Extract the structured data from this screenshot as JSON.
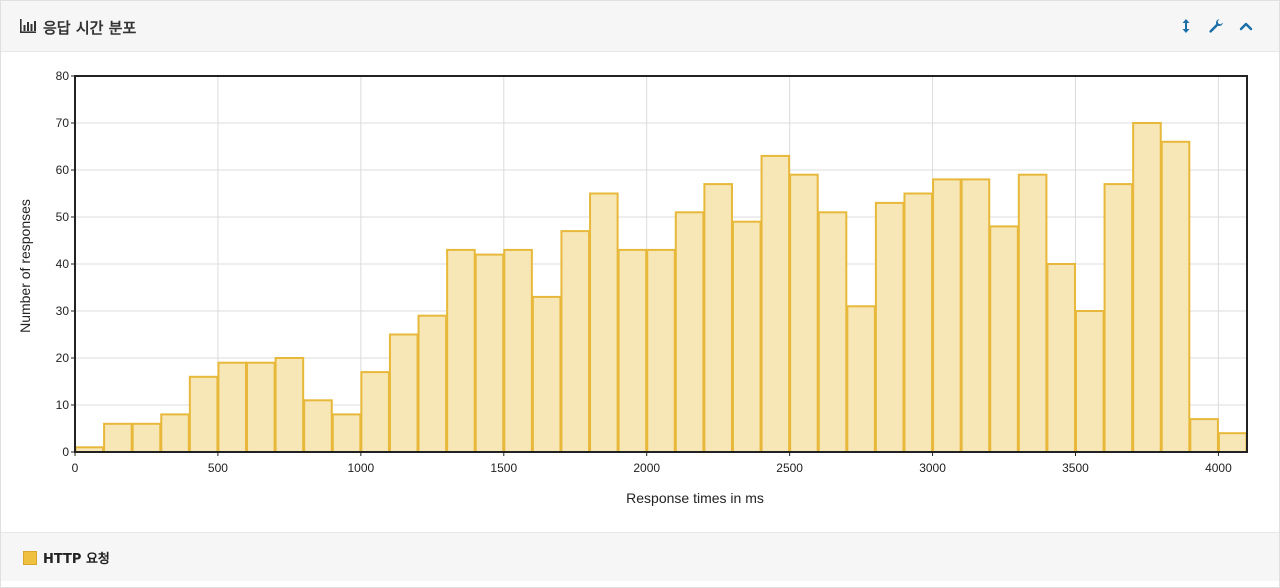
{
  "panel": {
    "title": "응답 시간 분포",
    "title_icon": "bar-chart-icon",
    "tools": [
      {
        "name": "resize-vertical-icon",
        "glyph": "↕"
      },
      {
        "name": "wrench-icon",
        "glyph": "🔧"
      },
      {
        "name": "collapse-icon",
        "glyph": "⌃"
      }
    ]
  },
  "legend": {
    "label": "HTTP 요청"
  },
  "colors": {
    "bar_fill": "#f7e6b6",
    "bar_stroke": "#e7b83a",
    "accent": "#1a6fa8"
  },
  "chart_data": {
    "type": "bar",
    "xlabel": "Response times in ms",
    "ylabel": "Number of responses",
    "xlim": [
      0,
      4100
    ],
    "ylim": [
      0,
      80
    ],
    "bin_width": 100,
    "x_ticks": [
      0,
      500,
      1000,
      1500,
      2000,
      2500,
      3000,
      3500,
      4000
    ],
    "y_ticks": [
      0,
      10,
      20,
      30,
      40,
      50,
      60,
      70,
      80
    ],
    "grid": true,
    "series": [
      {
        "name": "HTTP 요청",
        "bins": [
          0,
          100,
          200,
          300,
          400,
          500,
          600,
          700,
          800,
          900,
          1000,
          1100,
          1200,
          1300,
          1400,
          1500,
          1600,
          1700,
          1800,
          1900,
          2000,
          2100,
          2200,
          2300,
          2400,
          2500,
          2600,
          2700,
          2800,
          2900,
          3000,
          3100,
          3200,
          3300,
          3400,
          3500,
          3600,
          3700,
          3800,
          3900,
          4000
        ],
        "values": [
          1,
          6,
          6,
          8,
          16,
          19,
          19,
          20,
          11,
          8,
          17,
          25,
          29,
          43,
          42,
          43,
          33,
          47,
          55,
          43,
          43,
          51,
          57,
          49,
          63,
          59,
          51,
          31,
          53,
          55,
          58,
          58,
          48,
          59,
          40,
          30,
          57,
          70,
          66,
          7,
          4
        ]
      }
    ]
  }
}
